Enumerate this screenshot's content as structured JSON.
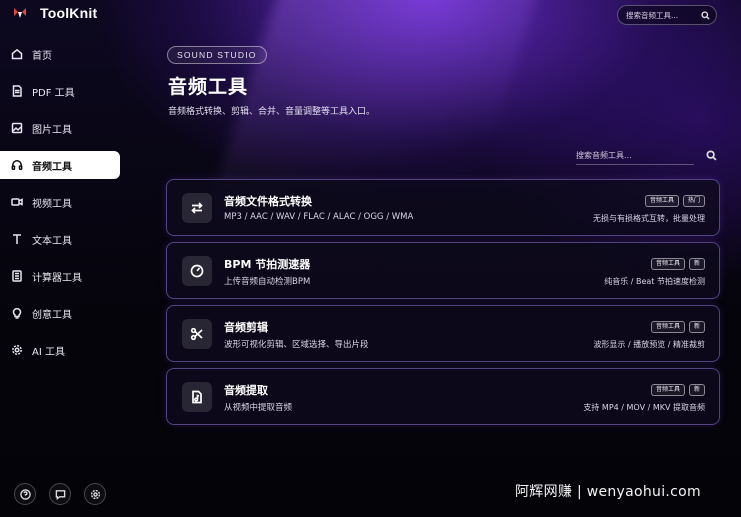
{
  "app": {
    "name": "ToolKnit"
  },
  "top_search": {
    "placeholder": "搜索音频工具..."
  },
  "sidebar": {
    "items": [
      {
        "label": "首页",
        "icon": "home-icon"
      },
      {
        "label": "PDF 工具",
        "icon": "document-icon"
      },
      {
        "label": "图片工具",
        "icon": "image-icon"
      },
      {
        "label": "音频工具",
        "icon": "headphones-icon",
        "active": true
      },
      {
        "label": "视频工具",
        "icon": "video-icon"
      },
      {
        "label": "文本工具",
        "icon": "text-icon"
      },
      {
        "label": "计算器工具",
        "icon": "calculator-icon"
      },
      {
        "label": "创意工具",
        "icon": "bulb-icon"
      },
      {
        "label": "AI 工具",
        "icon": "gear-icon"
      }
    ],
    "bottom_icons": [
      "help-icon",
      "chat-icon",
      "settings-icon"
    ]
  },
  "header": {
    "badge": "SOUND STUDIO",
    "title": "音频工具",
    "description": "音频格式转换、剪辑、合并、音量调整等工具入口。"
  },
  "list_search": {
    "placeholder": "搜索音频工具..."
  },
  "tools": [
    {
      "title": "音频文件格式转换",
      "subtitle": "MP3 / AAC / WAV / FLAC / ALAC / OGG / WMA",
      "tags": [
        "音频工具",
        "热门"
      ],
      "meta": "无损与有损格式互转，批量处理",
      "icon": "swap-arrows-icon"
    },
    {
      "title": "BPM 节拍测速器",
      "subtitle": "上传音频自动检测BPM",
      "tags": [
        "音频工具",
        "新"
      ],
      "meta": "纯音乐 / Beat 节拍速度检测",
      "icon": "gauge-icon"
    },
    {
      "title": "音频剪辑",
      "subtitle": "波形可视化剪辑、区域选择、导出片段",
      "tags": [
        "音频工具",
        "新"
      ],
      "meta": "波形显示 / 播放预览 / 精准裁剪",
      "icon": "scissors-icon"
    },
    {
      "title": "音频提取",
      "subtitle": "从视频中提取音频",
      "tags": [
        "音频工具",
        "新"
      ],
      "meta": "支持 MP4 / MOV / MKV 提取音频",
      "icon": "audio-file-icon"
    }
  ],
  "watermark": "阿辉网赚 | wenyaohui.com",
  "colors": {
    "accent": "#7b3cf0",
    "card_border": "#aa8cff",
    "active_bg": "#ffffff"
  }
}
